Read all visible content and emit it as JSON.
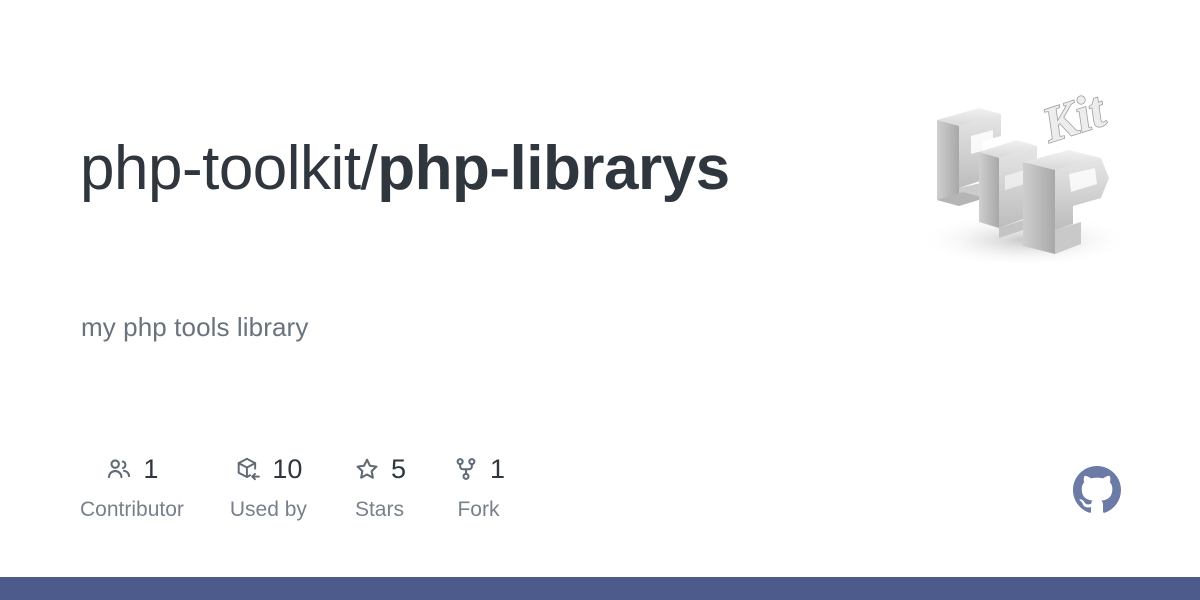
{
  "repo": {
    "owner": "php-toolkit/",
    "name": "php-librarys",
    "description": "my php tools library"
  },
  "stats": [
    {
      "icon": "people-icon",
      "value": "1",
      "label": "Contributor"
    },
    {
      "icon": "package-icon",
      "value": "10",
      "label": "Used by"
    },
    {
      "icon": "star-icon",
      "value": "5",
      "label": "Stars"
    },
    {
      "icon": "fork-icon",
      "value": "1",
      "label": "Fork"
    }
  ],
  "logo": {
    "name": "php-kit-logo",
    "primary_text": "PHP",
    "secondary_text": "Kit"
  },
  "brand": {
    "mark": "github-mark-icon"
  },
  "colors": {
    "title": "#2f363d",
    "description": "#6a737d",
    "stat_value": "#2f363d",
    "stat_label": "#77818c",
    "icon": "#606a75",
    "github_mark": "#6b7ba6",
    "bottom_bar": "#4d5a8c",
    "background": "#ffffff"
  }
}
